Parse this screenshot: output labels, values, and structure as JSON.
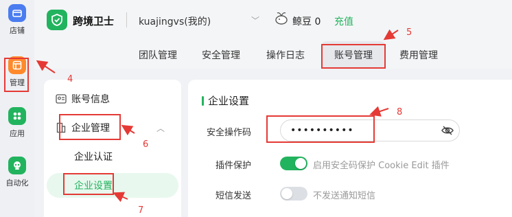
{
  "rail": {
    "items": [
      {
        "label": "店铺",
        "icon": "store-icon",
        "color": "#4a7cf0"
      },
      {
        "label": "管理",
        "icon": "manage-icon",
        "color": "#ff8a2b"
      },
      {
        "label": "应用",
        "icon": "apps-icon",
        "color": "#22b35e"
      },
      {
        "label": "自动化",
        "icon": "robot-icon",
        "color": "#22b35e"
      }
    ]
  },
  "header": {
    "brand": "跨境卫士",
    "account": "kuajingvs(我的)",
    "beans": "鲸豆 0",
    "recharge": "充值"
  },
  "tabs": [
    {
      "label": "团队管理"
    },
    {
      "label": "安全管理"
    },
    {
      "label": "操作日志"
    },
    {
      "label": "账号管理",
      "active": true
    },
    {
      "label": "费用管理"
    }
  ],
  "side_menu": {
    "account_info": "账号信息",
    "enterprise_manage": "企业管理",
    "enterprise_cert": "企业认证",
    "enterprise_settings": "企业设置"
  },
  "settings": {
    "title": "企业设置",
    "security_code_label": "安全操作码",
    "security_code_value": "••••••••••",
    "plugin_label": "插件保护",
    "plugin_text": "启用安全码保护 Cookie Edit 插件",
    "plugin_on": true,
    "sms_label": "短信发送",
    "sms_text": "不发送通知短信",
    "sms_on": false
  },
  "annotations": [
    "4",
    "5",
    "6",
    "7",
    "8"
  ],
  "colors": {
    "accent": "#22b35e",
    "annotation": "#e53935"
  }
}
